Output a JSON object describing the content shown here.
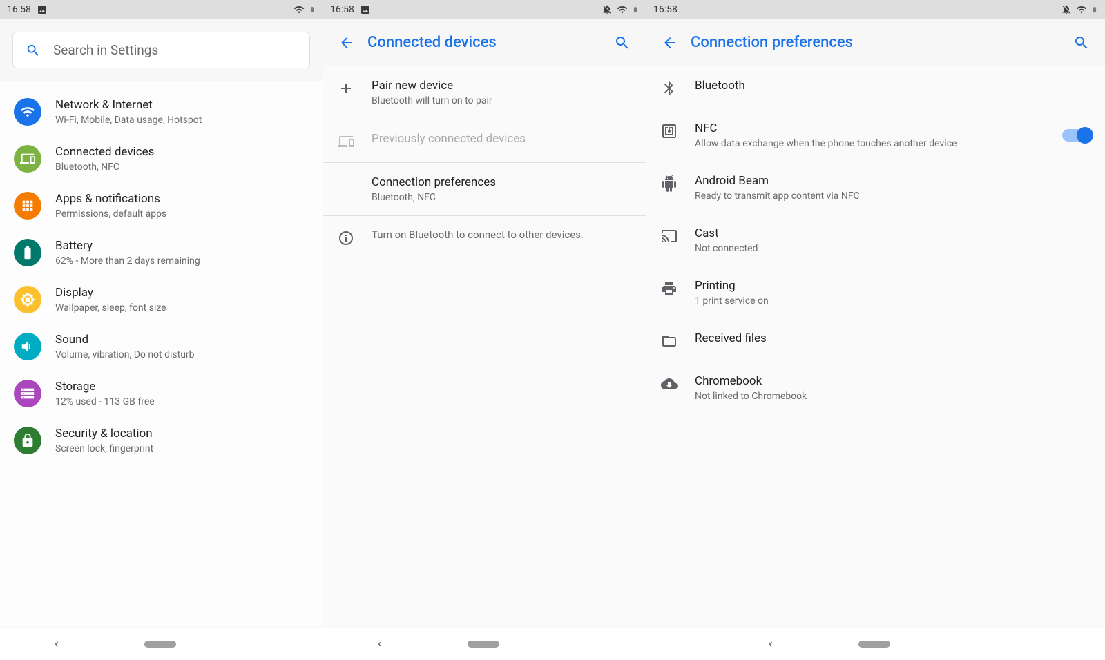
{
  "status_time": "16:58",
  "screen1": {
    "search_placeholder": "Search in Settings",
    "items": [
      {
        "title": "Network & Internet",
        "sub": "Wi-Fi, Mobile, Data usage, Hotspot",
        "color": "#1a73e8",
        "icon": "wifi"
      },
      {
        "title": "Connected devices",
        "sub": "Bluetooth, NFC",
        "color": "#7cb342",
        "icon": "devices"
      },
      {
        "title": "Apps & notifications",
        "sub": "Permissions, default apps",
        "color": "#f57c00",
        "icon": "apps"
      },
      {
        "title": "Battery",
        "sub": "62% - More than 2 days remaining",
        "color": "#00796b",
        "icon": "battery"
      },
      {
        "title": "Display",
        "sub": "Wallpaper, sleep, font size",
        "color": "#fbc02d",
        "icon": "brightness"
      },
      {
        "title": "Sound",
        "sub": "Volume, vibration, Do not disturb",
        "color": "#00acc1",
        "icon": "sound"
      },
      {
        "title": "Storage",
        "sub": "12% used - 113 GB free",
        "color": "#ab47bc",
        "icon": "storage"
      },
      {
        "title": "Security & location",
        "sub": "Screen lock, fingerprint",
        "color": "#2e7d32",
        "icon": "lock"
      }
    ]
  },
  "screen2": {
    "title": "Connected devices",
    "pair": {
      "title": "Pair new device",
      "sub": "Bluetooth will turn on to pair"
    },
    "previous": "Previously connected devices",
    "prefs": {
      "title": "Connection preferences",
      "sub": "Bluetooth, NFC"
    },
    "hint": "Turn on Bluetooth to connect to other devices."
  },
  "screen3": {
    "title": "Connection preferences",
    "items": [
      {
        "title": "Bluetooth",
        "sub": "",
        "icon": "bluetooth",
        "toggle": false
      },
      {
        "title": "NFC",
        "sub": "Allow data exchange when the phone touches another device",
        "icon": "nfc",
        "toggle": true
      },
      {
        "title": "Android Beam",
        "sub": "Ready to transmit app content via NFC",
        "icon": "android",
        "toggle": false
      },
      {
        "title": "Cast",
        "sub": "Not connected",
        "icon": "cast",
        "toggle": false
      },
      {
        "title": "Printing",
        "sub": "1 print service on",
        "icon": "print",
        "toggle": false
      },
      {
        "title": "Received files",
        "sub": "",
        "icon": "folder",
        "toggle": false
      },
      {
        "title": "Chromebook",
        "sub": "Not linked to Chromebook",
        "icon": "cloud-download",
        "toggle": false
      }
    ]
  }
}
